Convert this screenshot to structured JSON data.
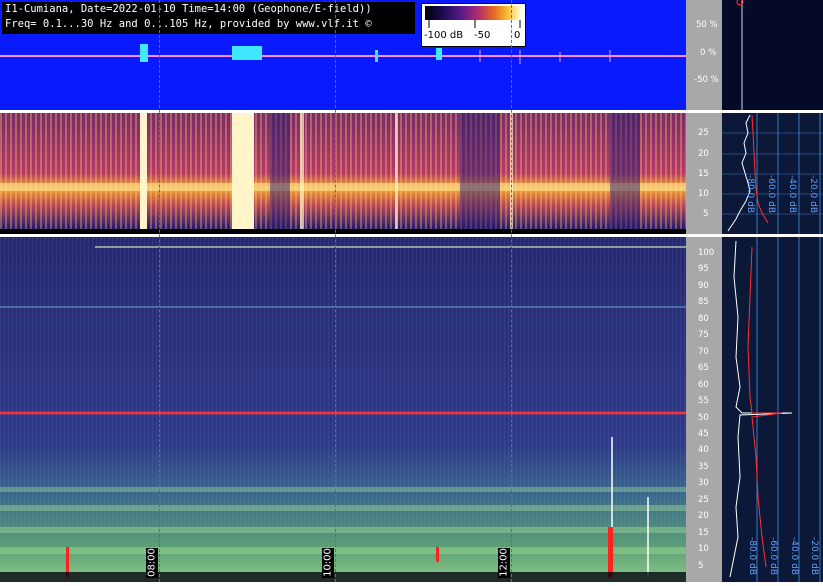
{
  "header": {
    "line1": "I1-Cumiana, Date=2022-01-10 Time=14:00 (Geophone/E-field))",
    "line2": "Freq= 0.1...30 Hz and 0...105 Hz, provided by www.vlf.it ©"
  },
  "colorbar": {
    "labels": [
      "-100 dB",
      "-50",
      "0"
    ]
  },
  "waveform_axis": {
    "ticks": [
      "50 %",
      "0 %",
      "-50 %"
    ]
  },
  "spec1_axis": {
    "ticks": [
      "25",
      "20",
      "15",
      "10",
      "5"
    ]
  },
  "spec2_axis": {
    "ticks": [
      "100",
      "95",
      "90",
      "85",
      "80",
      "75",
      "70",
      "65",
      "60",
      "55",
      "50",
      "45",
      "40",
      "35",
      "30",
      "25",
      "20",
      "15",
      "10",
      "5"
    ]
  },
  "side_s1": {
    "labels": [
      "-80.0 dB",
      "-60.0 dB",
      "-40.0 dB",
      "-20.0 dB"
    ]
  },
  "side_s2": {
    "labels": [
      "-80.0 dB",
      "-60.0 dB",
      "-40.0 dB",
      "-20.0 dB"
    ]
  },
  "time_labels": [
    "08:00",
    "10:00",
    "12:00"
  ],
  "colors": {
    "waveform_bg": "#0a1aff",
    "spectrogram_low": "#2a2c74",
    "marker_line": "#e0402a",
    "signal_line": "#ff3030"
  }
}
